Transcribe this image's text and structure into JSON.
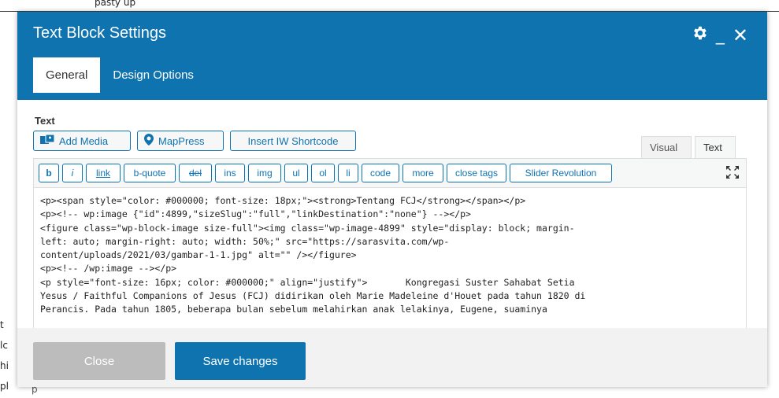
{
  "background": {
    "top_text": "pasty up",
    "left_fragments": [
      "t",
      "lc",
      "hi",
      "pl"
    ],
    "bottom_text": "p"
  },
  "modal": {
    "title": "Text Block Settings",
    "icons": [
      "gear-icon",
      "minimize-icon",
      "close-icon"
    ],
    "tabs": [
      {
        "label": "General",
        "active": true
      },
      {
        "label": "Design Options",
        "active": false
      }
    ]
  },
  "field": {
    "label": "Text",
    "media_buttons": [
      "Add Media",
      "MapPress",
      "Insert IW Shortcode"
    ],
    "editor_tabs": [
      "Visual",
      "Text"
    ],
    "quicktags": [
      "b",
      "i",
      "link",
      "b-quote",
      "del",
      "ins",
      "img",
      "ul",
      "ol",
      "li",
      "code",
      "more",
      "close tags",
      "Slider Revolution"
    ],
    "code_lines": [
      "<p><span style=\"color: #000000; font-size: 18px;\"><strong>Tentang FCJ</strong></span></p>",
      "<p><!-- wp:image {\"id\":4899,\"sizeSlug\":\"full\",\"linkDestination\":\"none\"} --></p>",
      "<figure class=\"wp-block-image size-full\"><img class=\"wp-image-4899\" style=\"display: block; margin-",
      "left: auto; margin-right: auto; width: 50%;\" src=\"https://sarasvita.com/wp-",
      "content/uploads/2021/03/gambar-1-1.jpg\" alt=\"\" /></figure>",
      "<p><!-- /wp:image --></p>",
      "<p style=\"font-size: 16px; color: #000000;\" align=\"justify\">       Kongregasi Suster Sahabat Setia",
      "Yesus / Faithful Companions of Jesus (FCJ) didirikan oleh Marie Madeleine d'Houet pada tahun 1820 di",
      "Perancis. Pada tahun 1805, beberapa bulan sebelum melahirkan anak lelakinya, Eugene, suaminya"
    ]
  },
  "footer": {
    "close_label": "Close",
    "save_label": "Save changes"
  },
  "colors": {
    "header": "#0f73b0",
    "disabled": "#bcbcbc"
  }
}
